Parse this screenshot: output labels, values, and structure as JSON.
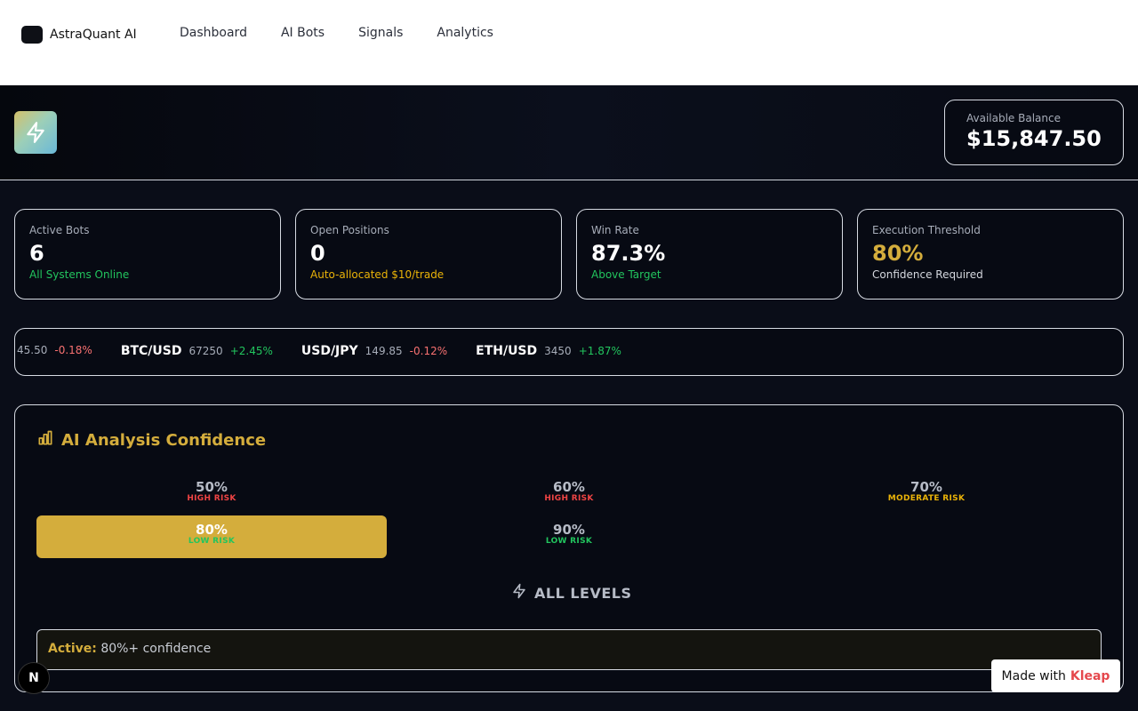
{
  "nav": {
    "brand": "AstraQuant AI",
    "links": [
      "Dashboard",
      "AI Bots",
      "Signals",
      "Analytics"
    ]
  },
  "hero": {
    "balance_label": "Available Balance",
    "balance_value": "$15,847.50"
  },
  "stats": [
    {
      "label": "Active Bots",
      "value": "6",
      "sub": "All Systems Online",
      "sub_color": "#22c55e"
    },
    {
      "label": "Open Positions",
      "value": "0",
      "sub": "Auto-allocated $10/trade",
      "sub_color": "#eab308"
    },
    {
      "label": "Win Rate",
      "value": "87.3%",
      "sub": "Above Target",
      "sub_color": "#22c55e"
    },
    {
      "label": "Execution Threshold",
      "value": "80%",
      "sub": "Confidence Required",
      "value_color": "#d4ad3c"
    }
  ],
  "ticker": [
    {
      "symbol": "",
      "price": "45.50",
      "change": "-0.18%",
      "direction": "down"
    },
    {
      "symbol": "BTC/USD",
      "price": "67250",
      "change": "+2.45%",
      "direction": "up"
    },
    {
      "symbol": "USD/JPY",
      "price": "149.85",
      "change": "-0.12%",
      "direction": "down"
    },
    {
      "symbol": "ETH/USD",
      "price": "3450",
      "change": "+1.87%",
      "direction": "up"
    }
  ],
  "confidence": {
    "title": "AI Analysis Confidence",
    "levels": [
      {
        "pct": "50%",
        "risk": "HIGH RISK",
        "risk_class": "risk-high",
        "active": false
      },
      {
        "pct": "60%",
        "risk": "HIGH RISK",
        "risk_class": "risk-high",
        "active": false
      },
      {
        "pct": "70%",
        "risk": "MODERATE RISK",
        "risk_class": "risk-mod",
        "active": false
      },
      {
        "pct": "80%",
        "risk": "LOW RISK",
        "risk_class": "risk-low",
        "active": true
      },
      {
        "pct": "90%",
        "risk": "LOW RISK",
        "risk_class": "risk-low",
        "active": false
      }
    ],
    "all_levels_label": "ALL LEVELS",
    "active_key": "Active:",
    "active_value": "80%+ confidence"
  },
  "footer": {
    "badge": "N",
    "made_with": "Made with",
    "made_brand": "Kleap"
  },
  "colors": {
    "accent_gold": "#d4ad3c",
    "up": "#22c55e",
    "down": "#f87171",
    "warning": "#eab308"
  },
  "icons": {
    "hero_tile": "lightning-bolt-icon",
    "panel_title": "bar-chart-icon",
    "all_levels": "lightning-bolt-icon"
  }
}
